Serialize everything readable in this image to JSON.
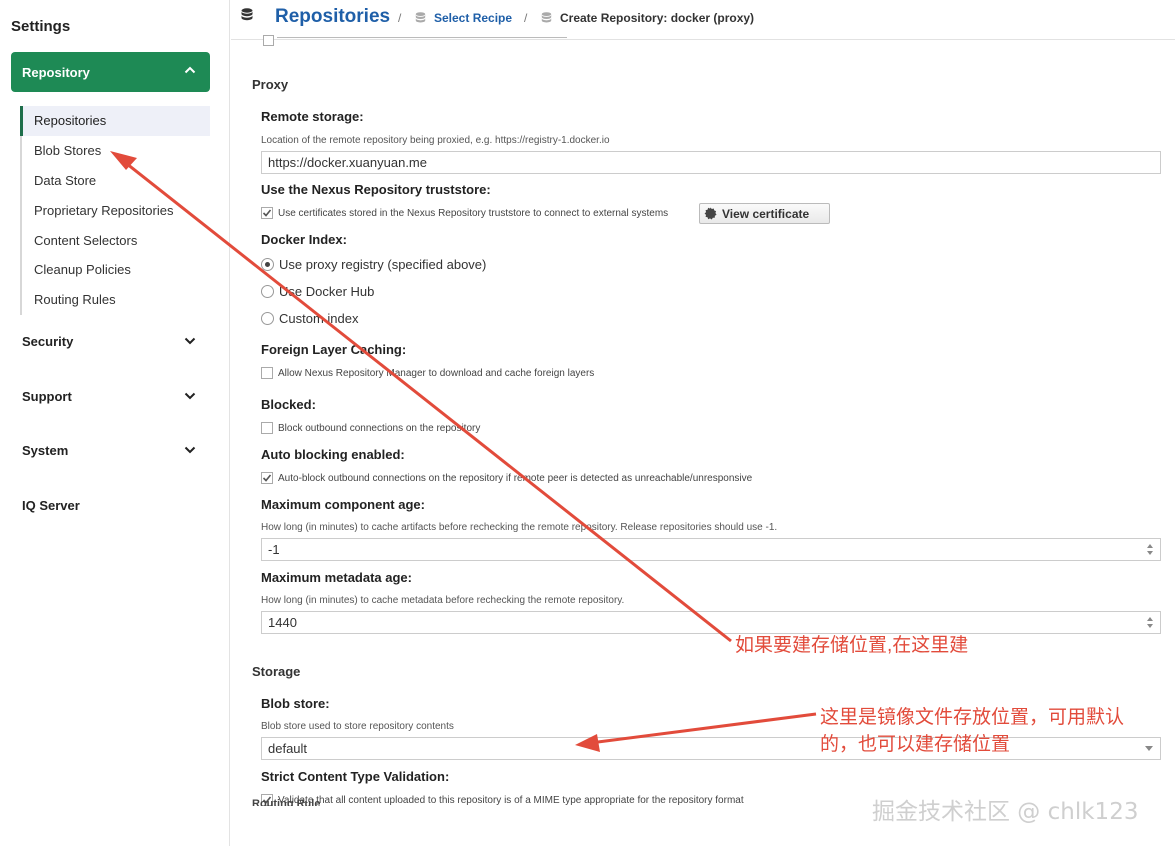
{
  "sidebar": {
    "title": "Settings",
    "active_section": "Repository",
    "sub_items": [
      {
        "label": "Repositories",
        "active": true
      },
      {
        "label": "Blob Stores",
        "active": false
      },
      {
        "label": "Data Store",
        "active": false
      },
      {
        "label": "Proprietary Repositories",
        "active": false
      },
      {
        "label": "Content Selectors",
        "active": false
      },
      {
        "label": "Cleanup Policies",
        "active": false
      },
      {
        "label": "Routing Rules",
        "active": false
      }
    ],
    "sections": [
      {
        "label": "Security",
        "icon": "chevron-down-icon"
      },
      {
        "label": "Support",
        "icon": "chevron-down-icon"
      },
      {
        "label": "System",
        "icon": "chevron-down-icon"
      },
      {
        "label": "IQ Server"
      }
    ],
    "accent_color": "#1e8a55"
  },
  "header": {
    "title": "Repositories",
    "sep": "/",
    "crumb_link": "Select Recipe",
    "crumb_current": "Create Repository: docker (proxy)",
    "icon": "database-icon"
  },
  "proxy": {
    "heading": "Proxy",
    "remote_storage": {
      "label": "Remote storage:",
      "help": "Location of the remote repository being proxied, e.g. https://registry-1.docker.io",
      "value": "https://docker.xuanyuan.me"
    },
    "truststore": {
      "label": "Use the Nexus Repository truststore:",
      "checkbox_label": "Use certificates stored in the Nexus Repository truststore to connect to external systems",
      "checked": true,
      "button": "View certificate"
    },
    "docker_index": {
      "label": "Docker Index:",
      "options": [
        {
          "label": "Use proxy registry (specified above)",
          "selected": true
        },
        {
          "label": "Use Docker Hub",
          "selected": false
        },
        {
          "label": "Custom index",
          "selected": false
        }
      ]
    },
    "foreign_layer": {
      "label": "Foreign Layer Caching:",
      "checkbox_label": "Allow Nexus Repository Manager to download and cache foreign layers",
      "checked": false
    },
    "blocked": {
      "label": "Blocked:",
      "checkbox_label": "Block outbound connections on the repository",
      "checked": false
    },
    "auto_blocking": {
      "label": "Auto blocking enabled:",
      "checkbox_label": "Auto-block outbound connections on the repository if remote peer is detected as unreachable/unresponsive",
      "checked": true
    },
    "max_component_age": {
      "label": "Maximum component age:",
      "help": "How long (in minutes) to cache artifacts before rechecking the remote repository. Release repositories should use -1.",
      "value": "-1"
    },
    "max_metadata_age": {
      "label": "Maximum metadata age:",
      "help": "How long (in minutes) to cache metadata before rechecking the remote repository.",
      "value": "1440"
    }
  },
  "storage": {
    "heading": "Storage",
    "blob_store": {
      "label": "Blob store:",
      "help": "Blob store used to store repository contents",
      "value": "default"
    },
    "strict_validation": {
      "label": "Strict Content Type Validation:",
      "checkbox_label": "Validate that all content uploaded to this repository is of a MIME type appropriate for the repository format",
      "checked": true
    }
  },
  "next_section_cut": "Routing Rule",
  "annotations": {
    "note1": "如果要建存储位置,在这里建",
    "note2": "这里是镜像文件存放位置，可用默认的，也可以建存储位置",
    "color": "#e24b3b"
  },
  "watermark": "掘金技术社区 @ chlk123"
}
